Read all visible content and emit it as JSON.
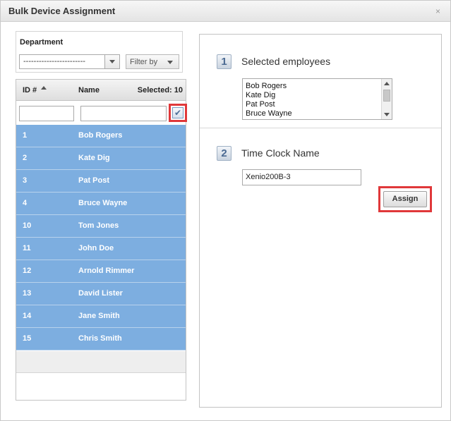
{
  "window": {
    "title": "Bulk Device Assignment",
    "close_glyph": "×"
  },
  "department": {
    "label": "Department",
    "selected": "------------------------",
    "filter_label": "Filter by"
  },
  "grid": {
    "columns": {
      "id": "ID #",
      "name": "Name",
      "selected": "Selected: 10"
    },
    "filter": {
      "id_value": "",
      "name_value": ""
    },
    "check_glyph": "✔",
    "rows": [
      {
        "id": "1",
        "name": "Bob Rogers"
      },
      {
        "id": "2",
        "name": "Kate Dig"
      },
      {
        "id": "3",
        "name": "Pat Post"
      },
      {
        "id": "4",
        "name": "Bruce Wayne"
      },
      {
        "id": "10",
        "name": "Tom Jones"
      },
      {
        "id": "11",
        "name": "John Doe"
      },
      {
        "id": "12",
        "name": "Arnold Rimmer"
      },
      {
        "id": "13",
        "name": "David Lister"
      },
      {
        "id": "14",
        "name": "Jane Smith"
      },
      {
        "id": "15",
        "name": "Chris Smith"
      }
    ]
  },
  "step1": {
    "number": "1",
    "title": "Selected employees",
    "items": [
      "Bob Rogers",
      "Kate Dig",
      "Pat Post",
      "Bruce Wayne"
    ]
  },
  "step2": {
    "number": "2",
    "title": "Time Clock Name",
    "value": "Xenio200B-3",
    "assign_label": "Assign"
  },
  "colors": {
    "row_selected": "#7daee0",
    "highlight": "#e0383a"
  }
}
